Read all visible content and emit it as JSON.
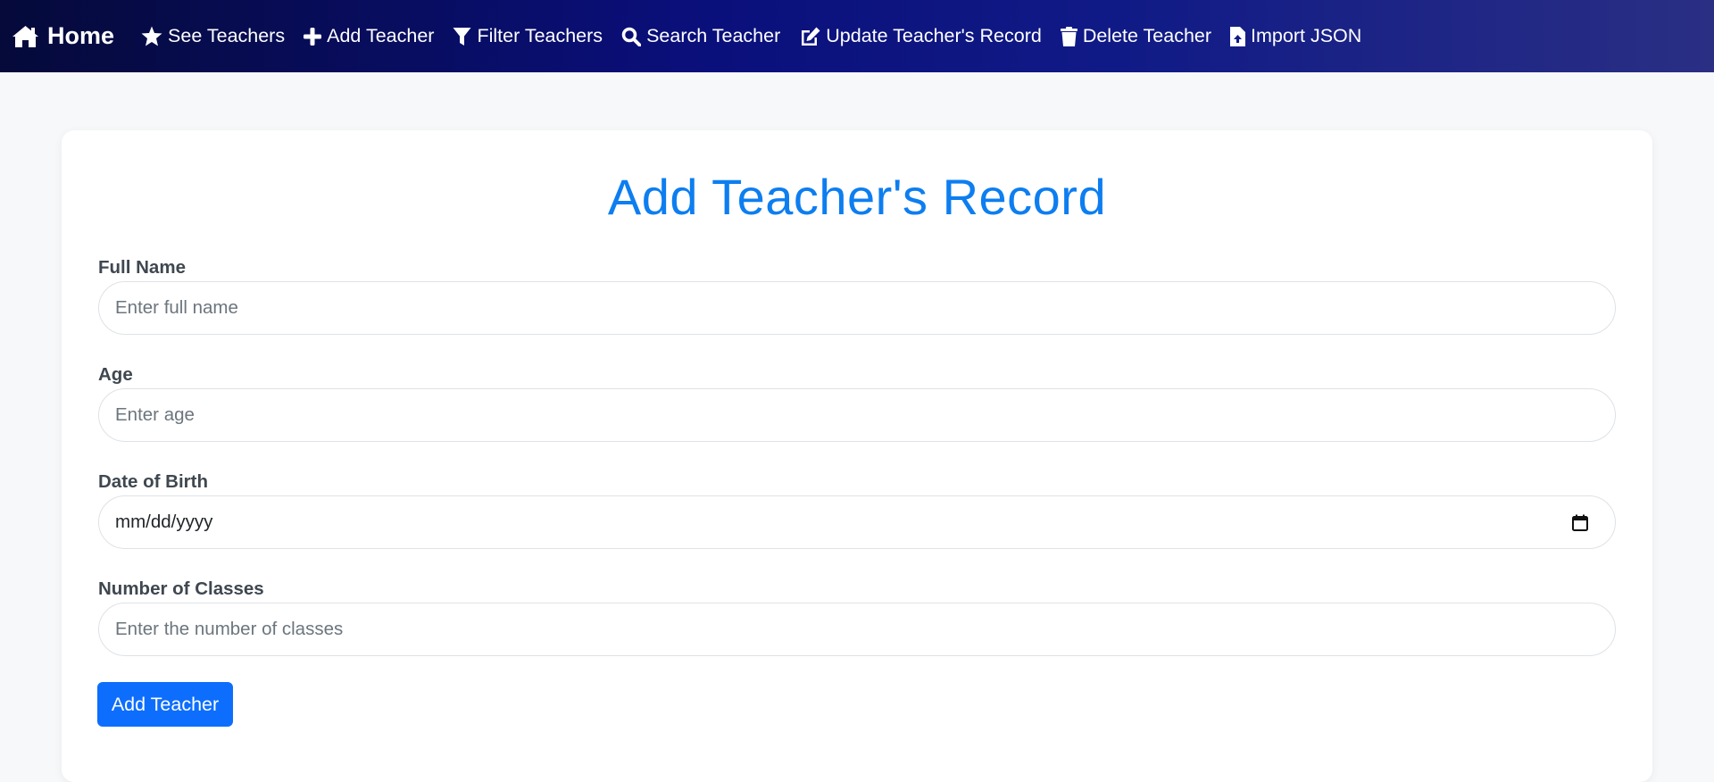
{
  "navbar": {
    "brand": {
      "label": "Home",
      "icon": "home-icon"
    },
    "items": [
      {
        "label": "See Teachers",
        "icon": "star-icon"
      },
      {
        "label": "Add Teacher",
        "icon": "plus-icon"
      },
      {
        "label": "Filter Teachers",
        "icon": "filter-icon"
      },
      {
        "label": "Search Teacher",
        "icon": "search-icon"
      },
      {
        "label": "Update Teacher's Record",
        "icon": "edit-icon"
      },
      {
        "label": "Delete Teacher",
        "icon": "trash-icon"
      },
      {
        "label": "Import JSON",
        "icon": "file-upload-icon"
      }
    ]
  },
  "form": {
    "title": "Add Teacher's Record",
    "full_name": {
      "label": "Full Name",
      "placeholder": "Enter full name",
      "value": ""
    },
    "age": {
      "label": "Age",
      "placeholder": "Enter age",
      "value": ""
    },
    "dob": {
      "label": "Date of Birth",
      "placeholder": "mm/dd/yyyy",
      "value": ""
    },
    "classes": {
      "label": "Number of Classes",
      "placeholder": "Enter the number of classes",
      "value": ""
    },
    "submit_label": "Add Teacher"
  },
  "colors": {
    "title": "#0d7ef0",
    "button": "#0d6efd",
    "label": "#3f4750",
    "page_bg": "#f7f8fa"
  }
}
